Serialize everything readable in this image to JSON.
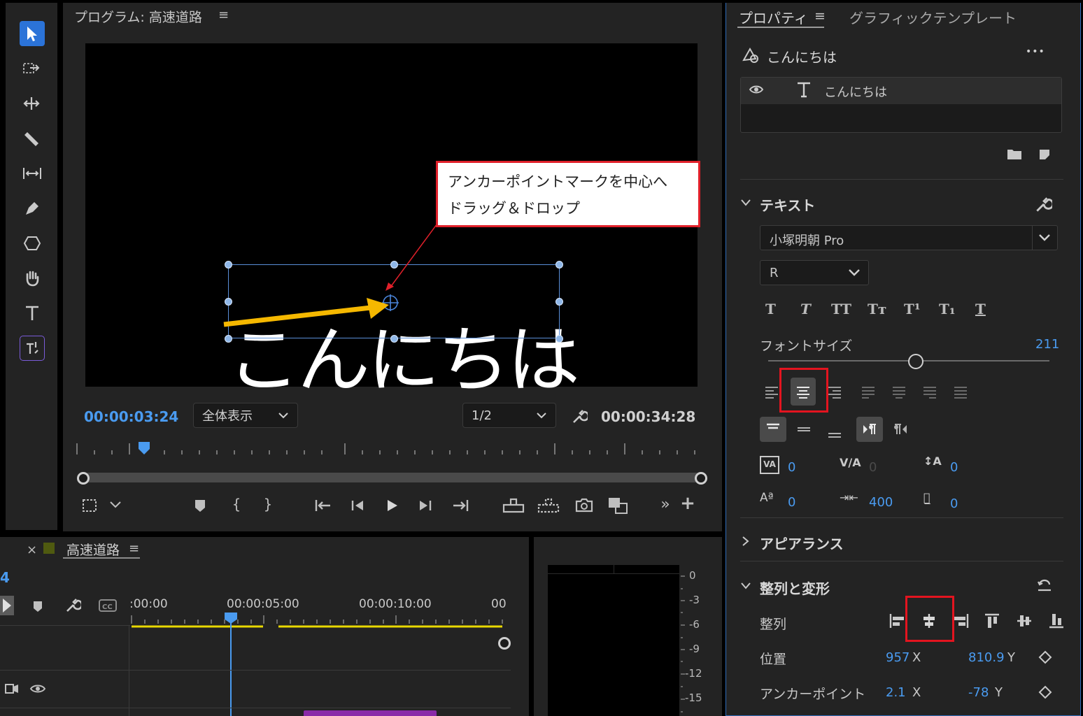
{
  "program": {
    "title": "プログラム: 高速道路",
    "menu_icon": "≡",
    "title_text": "こんにちは",
    "callout_line1": "アンカーポイントマークを中心へ",
    "callout_line2": "ドラッグ＆ドロップ",
    "current_time": "00:00:03:24",
    "zoom": "全体表示",
    "resolution": "1/2",
    "duration": "00:00:34:28"
  },
  "timeline": {
    "close": "×",
    "name": "高速道路",
    "menu_icon": "≡",
    "frame_digit": "4",
    "ruler": [
      ":00:00",
      "00:00:05:00",
      "00:00:10:00",
      "00"
    ]
  },
  "meter": {
    "scale": [
      "0",
      "-3",
      "-6",
      "-9",
      "-12",
      "-15"
    ]
  },
  "props": {
    "tab_properties": "プロパティ",
    "tab_menu": "≡",
    "tab_graphic": "グラフィックテンプレート",
    "layer_name": "こんにちは",
    "more": "•••",
    "layer_row": "こんにちは",
    "text_section": "テキスト",
    "font": "小塚明朝 Pro",
    "font_style": "R",
    "font_size_label": "フォントサイズ",
    "font_size": "211",
    "kerning": "0",
    "tracking": "0",
    "leading": "0",
    "baseline": "0",
    "tsume_val": "400",
    "tab_stop": "0",
    "appearance": "アピアランス",
    "align_section": "整列と変形",
    "align_label": "整列",
    "position_label": "位置",
    "pos_x": "957",
    "pos_y": "810.9",
    "x_suffix": "X",
    "y_suffix": "Y",
    "anchor_label": "アンカーポイント",
    "anchor_x": "2.1",
    "anchor_y": "-78"
  },
  "colors": {
    "accent_blue": "#4a9bf0",
    "highlight_red": "#e3141f",
    "arrow_yellow": "#f5b800"
  }
}
